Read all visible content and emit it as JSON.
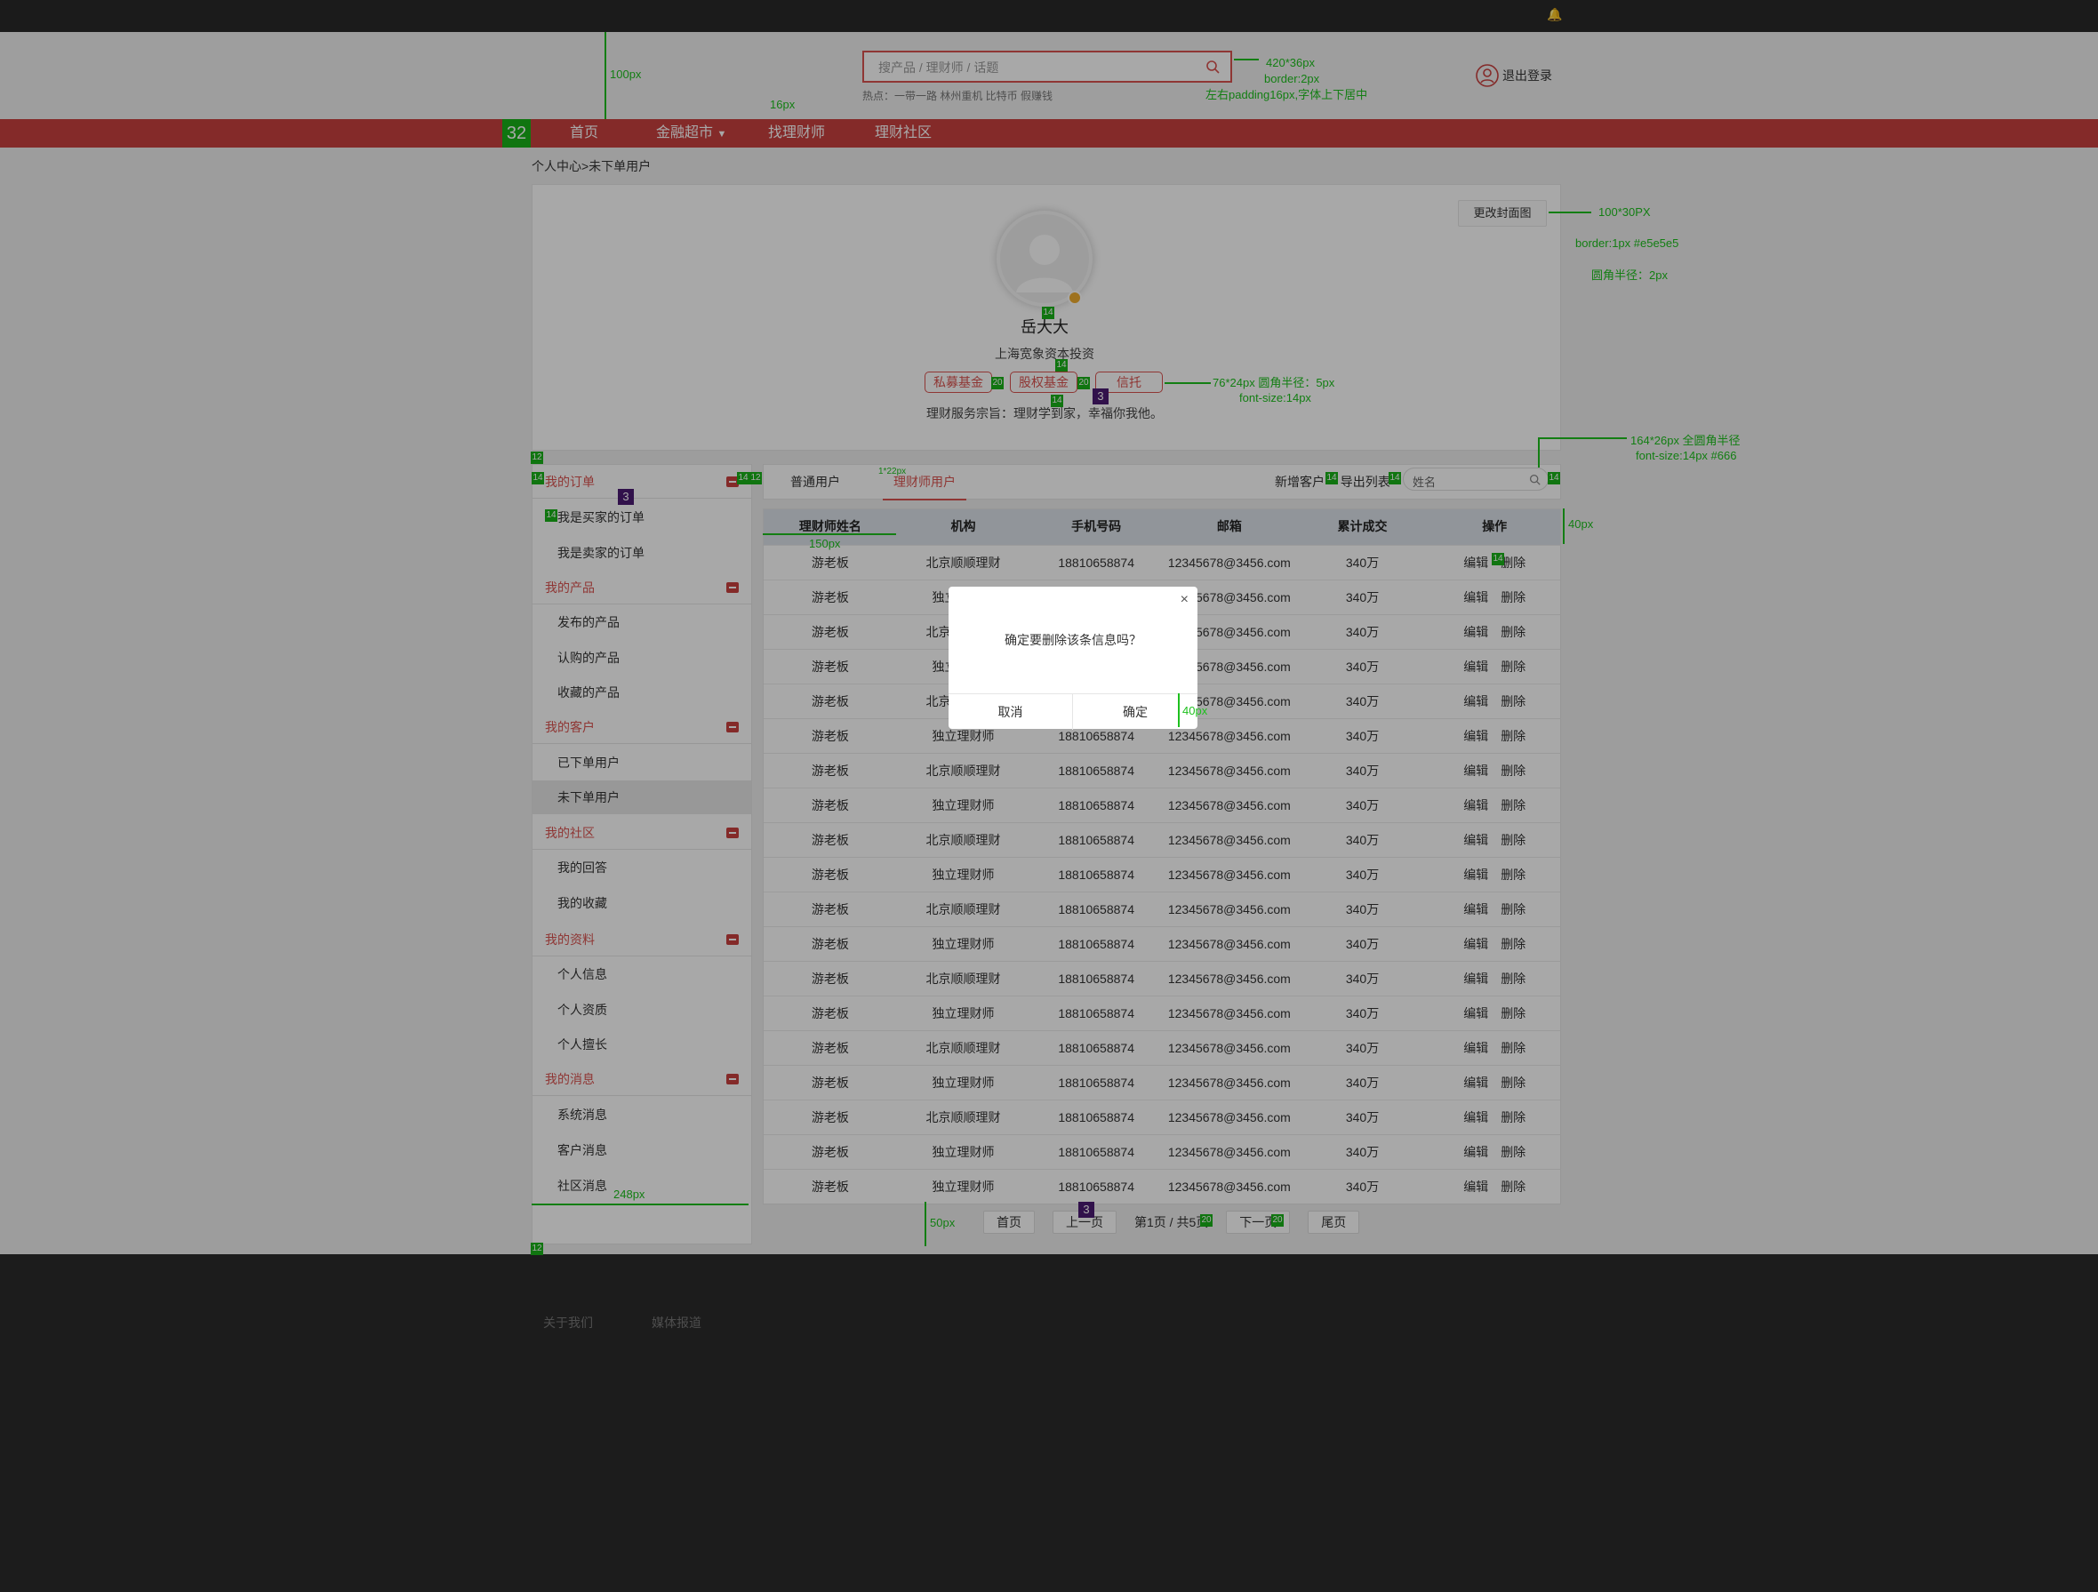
{
  "header": {
    "search_placeholder": "搜产品 / 理财师 / 话题",
    "hot_label": "热点：一带一路 林州重机 比特币 假赚钱",
    "logout": "退出登录"
  },
  "nav": {
    "logo": "32",
    "items": [
      "首页",
      "金融超市",
      "找理财师",
      "理财社区"
    ]
  },
  "breadcrumb": "个人中心>未下单用户",
  "profile": {
    "cover_button": "更改封面图",
    "name": "岳大大",
    "company": "上海宽象资本投资",
    "tags": [
      "私募基金",
      "股权基金",
      "信托"
    ],
    "motto": "理财服务宗旨：理财学到家，幸福你我他。"
  },
  "sidebar": {
    "groups": [
      {
        "title": "我的订单",
        "items": [
          "我是买家的订单",
          "我是卖家的订单"
        ]
      },
      {
        "title": "我的产品",
        "items": [
          "发布的产品",
          "认购的产品",
          "收藏的产品"
        ]
      },
      {
        "title": "我的客户",
        "items": [
          "已下单用户",
          "未下单用户"
        ]
      },
      {
        "title": "我的社区",
        "items": [
          "我的回答",
          "我的收藏"
        ]
      },
      {
        "title": "我的资料",
        "items": [
          "个人信息",
          "个人资质",
          "个人擅长"
        ]
      },
      {
        "title": "我的消息",
        "items": [
          "系统消息",
          "客户消息",
          "社区消息"
        ]
      }
    ]
  },
  "tabs": [
    "普通用户",
    "理财师用户"
  ],
  "actions": {
    "add": "新增客户",
    "export": "导出列表",
    "search_placeholder": "姓名"
  },
  "table": {
    "headers": [
      "理财师姓名",
      "机构",
      "手机号码",
      "邮箱",
      "累计成交",
      "操作"
    ],
    "rows": [
      [
        "游老板",
        "北京顺顺理财",
        "18810658874",
        "12345678@3456.com",
        "340万"
      ],
      [
        "游老板",
        "独立理财师",
        "18810658874",
        "12345678@3456.com",
        "340万"
      ],
      [
        "游老板",
        "北京顺顺理财",
        "18810658874",
        "12345678@3456.com",
        "340万"
      ],
      [
        "游老板",
        "独立理财师",
        "18810658874",
        "12345678@3456.com",
        "340万"
      ],
      [
        "游老板",
        "北京顺顺理财",
        "18810658874",
        "12345678@3456.com",
        "340万"
      ],
      [
        "游老板",
        "独立理财师",
        "18810658874",
        "12345678@3456.com",
        "340万"
      ],
      [
        "游老板",
        "北京顺顺理财",
        "18810658874",
        "12345678@3456.com",
        "340万"
      ],
      [
        "游老板",
        "独立理财师",
        "18810658874",
        "12345678@3456.com",
        "340万"
      ],
      [
        "游老板",
        "北京顺顺理财",
        "18810658874",
        "12345678@3456.com",
        "340万"
      ],
      [
        "游老板",
        "独立理财师",
        "18810658874",
        "12345678@3456.com",
        "340万"
      ],
      [
        "游老板",
        "北京顺顺理财",
        "18810658874",
        "12345678@3456.com",
        "340万"
      ],
      [
        "游老板",
        "独立理财师",
        "18810658874",
        "12345678@3456.com",
        "340万"
      ],
      [
        "游老板",
        "北京顺顺理财",
        "18810658874",
        "12345678@3456.com",
        "340万"
      ],
      [
        "游老板",
        "独立理财师",
        "18810658874",
        "12345678@3456.com",
        "340万"
      ],
      [
        "游老板",
        "北京顺顺理财",
        "18810658874",
        "12345678@3456.com",
        "340万"
      ],
      [
        "游老板",
        "独立理财师",
        "18810658874",
        "12345678@3456.com",
        "340万"
      ],
      [
        "游老板",
        "北京顺顺理财",
        "18810658874",
        "12345678@3456.com",
        "340万"
      ],
      [
        "游老板",
        "独立理财师",
        "18810658874",
        "12345678@3456.com",
        "340万"
      ],
      [
        "游老板",
        "独立理财师",
        "18810658874",
        "12345678@3456.com",
        "340万"
      ]
    ],
    "edit": "编辑",
    "delete": "删除"
  },
  "pagination": {
    "first": "首页",
    "prev": "上一页",
    "info": "第1页 / 共5页",
    "next": "下一页",
    "last": "尾页"
  },
  "footer": {
    "about": "关于我们",
    "media": "媒体报道"
  },
  "dialog": {
    "close": "×",
    "message": "确定要删除该条信息吗？",
    "cancel": "取消",
    "ok": "确定"
  },
  "annotations": {
    "a100": "100px",
    "a16": "16px",
    "search1": "420*36px",
    "search2": "border:2px",
    "search3": "左右padding16px,字体上下居中",
    "cover1": "100*30PX",
    "cover2": "border:1px #e5e5e5",
    "cover3": "圆角半径：2px",
    "tag1": "76*24px 圆角半径：5px",
    "tag2": "font-size:14px",
    "ts1": "164*26px 全圆角半径",
    "ts2": "font-size:14px #666",
    "a40": "40px",
    "a150": "150px",
    "a248": "248px",
    "a50": "50px",
    "a1x22": "1*22px",
    "a40b": "40px",
    "n14": "14",
    "n12": "12",
    "n20": "20",
    "n3": "3"
  },
  "colors": {
    "brand_red": "#c9403f",
    "accent_green": "#1ec01e",
    "dark": "#292929"
  }
}
